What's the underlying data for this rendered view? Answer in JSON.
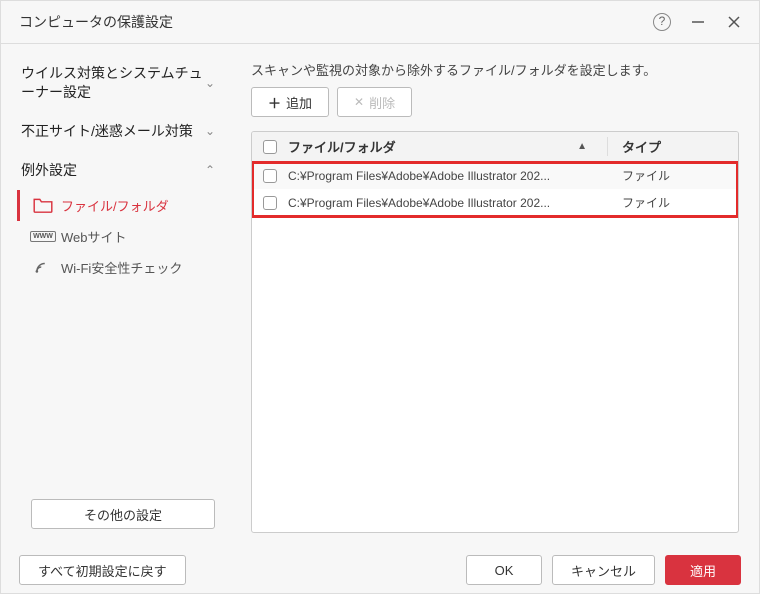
{
  "title": "コンピュータの保護設定",
  "sidebar": {
    "items": [
      {
        "label": "ウイルス対策とシステムチューナー設定"
      },
      {
        "label": "不正サイト/迷惑メール対策"
      },
      {
        "label": "例外設定"
      }
    ],
    "sub_items": [
      {
        "label": "ファイル/フォルダ"
      },
      {
        "label": "Webサイト"
      },
      {
        "label": "Wi-Fi安全性チェック"
      }
    ],
    "other_settings_label": "その他の設定"
  },
  "main": {
    "description": "スキャンや監視の対象から除外するファイル/フォルダを設定します。",
    "add_label": "追加",
    "delete_label": "削除",
    "columns": {
      "path": "ファイル/フォルダ",
      "type": "タイプ"
    },
    "rows": [
      {
        "path": "C:¥Program Files¥Adobe¥Adobe Illustrator 202...",
        "type": "ファイル"
      },
      {
        "path": "C:¥Program Files¥Adobe¥Adobe Illustrator 202...",
        "type": "ファイル"
      }
    ]
  },
  "footer": {
    "reset_label": "すべて初期設定に戻す",
    "ok_label": "OK",
    "cancel_label": "キャンセル",
    "apply_label": "適用"
  }
}
